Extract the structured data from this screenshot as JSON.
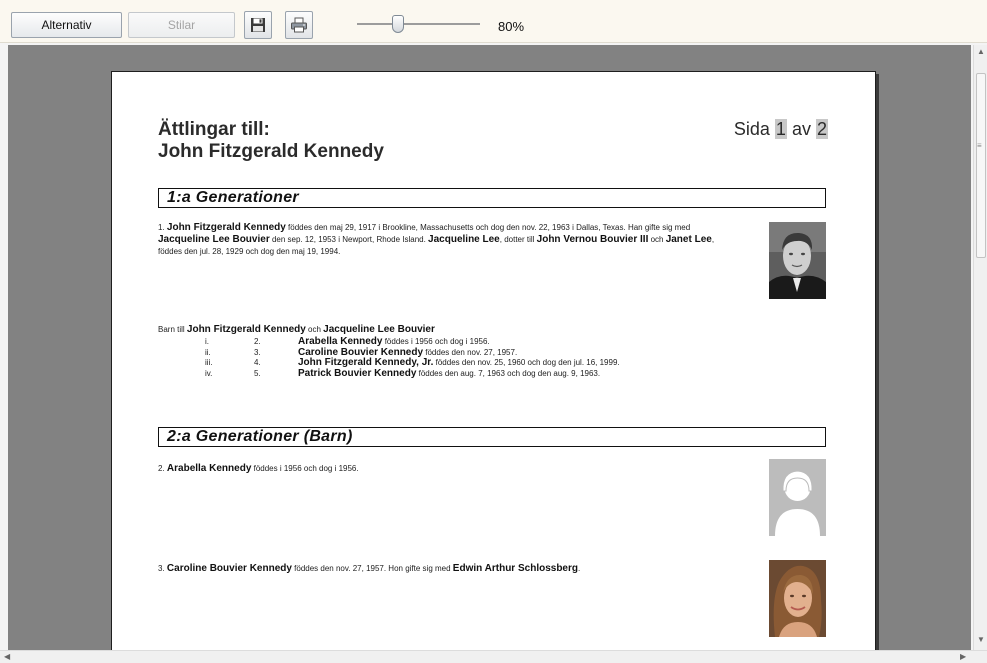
{
  "toolbar": {
    "alternativ_label": "Alternativ",
    "stilar_label": "Stilar",
    "save_icon": "floppy-disk-icon",
    "print_icon": "printer-icon",
    "zoom": "80%"
  },
  "page": {
    "title_line1": "Ättlingar till:",
    "title_line2": "John Fitzgerald Kennedy",
    "pageno": {
      "prefix": "Sida",
      "current": "1",
      "middle": "av",
      "total": "2"
    },
    "gen1": {
      "heading": "1:a Generationer",
      "entry": {
        "num": "1.",
        "name": "John Fitzgerald Kennedy",
        "t1": " föddes den maj 29, 1917 i Brookline, Massachusetts och dog den nov. 22, 1963 i Dallas, Texas.  Han gifte sig med ",
        "spouse": "Jacqueline Lee Bouvier",
        "t2": " den sep. 12, 1953 i Newport, Rhode Island. ",
        "spouse_short": "Jacqueline Lee",
        "t3": ", dotter till ",
        "father": "John Vernou Bouvier III",
        "t4": " och ",
        "mother": "Janet Lee",
        "t5": ", föddes den jul. 28, 1929 och dog den maj 19, 1994."
      },
      "children_intro": {
        "prefix": "Barn till ",
        "parent1": "John Fitzgerald Kennedy",
        "mid": " och ",
        "parent2": "Jacqueline Lee Bouvier"
      },
      "children": [
        {
          "roman": "i.",
          "num": "2.",
          "name": "Arabella Kennedy",
          "text": " föddes i 1956 och dog i 1956."
        },
        {
          "roman": "ii.",
          "num": "3.",
          "name": "Caroline Bouvier Kennedy",
          "text": " föddes den nov. 27, 1957."
        },
        {
          "roman": "iii.",
          "num": "4.",
          "name": "John Fitzgerald Kennedy, Jr.",
          "text": " föddes den nov. 25, 1960 och dog den jul. 16, 1999."
        },
        {
          "roman": "iv.",
          "num": "5.",
          "name": "Patrick Bouvier Kennedy",
          "text": " föddes den aug. 7, 1963 och dog den aug. 9, 1963."
        }
      ]
    },
    "gen2": {
      "heading": "2:a Generationer (Barn)",
      "entries": [
        {
          "num": "2.",
          "name": "Arabella Kennedy",
          "text": " föddes i 1956 och dog i 1956."
        },
        {
          "num": "3.",
          "name": "Caroline Bouvier Kennedy",
          "text": " föddes den nov. 27, 1957.  Hon gifte sig med ",
          "spouse": "Edwin Arthur Schlossberg",
          "end": "."
        }
      ]
    }
  }
}
